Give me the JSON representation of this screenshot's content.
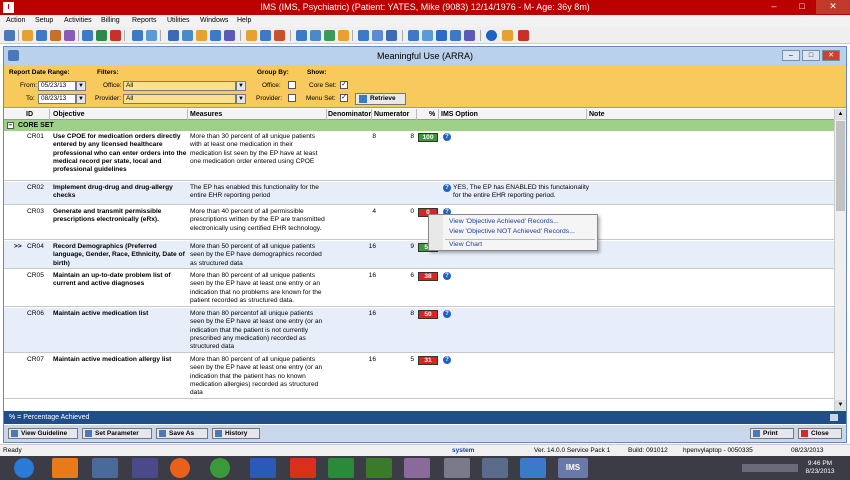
{
  "window": {
    "title": "IMS (IMS, Psychiatric)    (Patient: YATES, Mike  (9083) 12/14/1976 - M- Age: 36y 8m)",
    "app_icon": "IMS"
  },
  "menu": [
    "Action",
    "Setup",
    "Activities",
    "Billing",
    "Reports",
    "Utilities",
    "Windows",
    "Help"
  ],
  "child_window": {
    "title": "Meaningful Use (ARRA)"
  },
  "filters": {
    "report_date_range_label": "Report Date Range:",
    "from_label": "From:",
    "from_value": "05/23/13",
    "to_label": "To:",
    "to_value": "08/23/13",
    "filters_label": "Filters:",
    "office_label": "Office:",
    "office_value": "All",
    "provider_label": "Provider:",
    "provider_value": "All",
    "group_by_label": "Group By:",
    "group_office_label": "Office:",
    "group_provider_label": "Provider:",
    "show_label": "Show:",
    "core_set_label": "Core Set:",
    "menu_set_label": "Menu Set:",
    "retrieve_label": "Retrieve"
  },
  "table": {
    "headers": [
      "ID",
      "Objective",
      "Measures",
      "Denominator",
      "Numerator",
      "%",
      "IMS Option",
      "Note"
    ],
    "section_label": "CORE SET",
    "rows": [
      {
        "id": "CR01",
        "objective": "Use CPOE for medication orders directly entered by any licensed healthcare professional who can enter orders into the medical record per state, local and professional guidelines",
        "measure": "More than 30 percent of all unique patients with at least one medication in their medication list seen by the EP have at least one medication order entered using CPOE",
        "denominator": "8",
        "numerator": "8",
        "percent": "100",
        "status": "green",
        "option": "",
        "pointer": ""
      },
      {
        "id": "CR02",
        "objective": "Implement drug-drug and drug-allergy checks",
        "measure": "The EP has enabled this functionality for the entire EHR reporting period",
        "denominator": "",
        "numerator": "",
        "percent": "",
        "status": "",
        "option": "YES, The EP has ENABLED this functaionality for the entire EHR reporting period.",
        "pointer": ""
      },
      {
        "id": "CR03",
        "objective": "Generate and transmit permissible prescriptions electronically (eRx).",
        "measure": "More than 40 percent of all permissible prescriptions written by the EP are transmitted electronically using certified EHR technology.",
        "denominator": "4",
        "numerator": "0",
        "percent": "0",
        "status": "red",
        "option": "",
        "pointer": ""
      },
      {
        "id": "CR04",
        "objective": "Record Demographics (Preferred language, Gender, Race, Ethnicity, Date of birth)",
        "measure": "More than 50 percent of all unique patients seen by the EP have demographics recorded as structured data",
        "denominator": "16",
        "numerator": "9",
        "percent": "56",
        "status": "green",
        "option": "",
        "pointer": ">>"
      },
      {
        "id": "CR05",
        "objective": "Maintain an up-to-date problem list of current and active diagnoses",
        "measure": "More than 80 percent of all unique patients seen by the EP have at least one entry or an indication that no problems are known for the patient recorded as structured data.",
        "denominator": "16",
        "numerator": "6",
        "percent": "38",
        "status": "red",
        "option": "",
        "pointer": ""
      },
      {
        "id": "CR06",
        "objective": "Maintain active medication list",
        "measure": "More than 80 percentof all unique patients seen by the EP have at least one entry (or an indication that the patient is not currently prescribed any medication) recorded as structured data",
        "denominator": "16",
        "numerator": "8",
        "percent": "50",
        "status": "red",
        "option": "",
        "pointer": ""
      },
      {
        "id": "CR07",
        "objective": "Maintain active medication allergy list",
        "measure": "More than 80 percent of all unique patients seen by the EP have at least one entry (or an indication that the patient has no known medication allergies) recorded as structured data",
        "denominator": "16",
        "numerator": "5",
        "percent": "31",
        "status": "red",
        "option": "",
        "pointer": ""
      }
    ]
  },
  "context_menu": {
    "items": [
      "View 'Objective Achieved' Records...",
      "View 'Objective NOT Achieved' Records...",
      "View Chart"
    ]
  },
  "footer_text": "% = Percentage Achieved",
  "bottom_buttons": {
    "view_guideline": "View Guideline",
    "set_parameter": "Set Parameter",
    "save_as": "Save As",
    "history": "History",
    "print": "Print",
    "close": "Close"
  },
  "status_bar": {
    "ready": "Ready",
    "user": "system",
    "version": "Ver. 14.0.0 Service Pack 1",
    "build": "Build: 091012",
    "machine": "hpenvylaptop - 0050335",
    "date": "08/23/2013"
  },
  "taskbar": {
    "time": "9:46 PM",
    "date": "8/23/2013",
    "ims_label": "IMS"
  },
  "colors": {
    "title_red": "#bb0000",
    "filter_yellow": "#f8c95c",
    "section_green": "#9fd08a",
    "footer_blue": "#1f4e8a",
    "pct_green": "#3a9a3a",
    "pct_red": "#dd2222"
  }
}
